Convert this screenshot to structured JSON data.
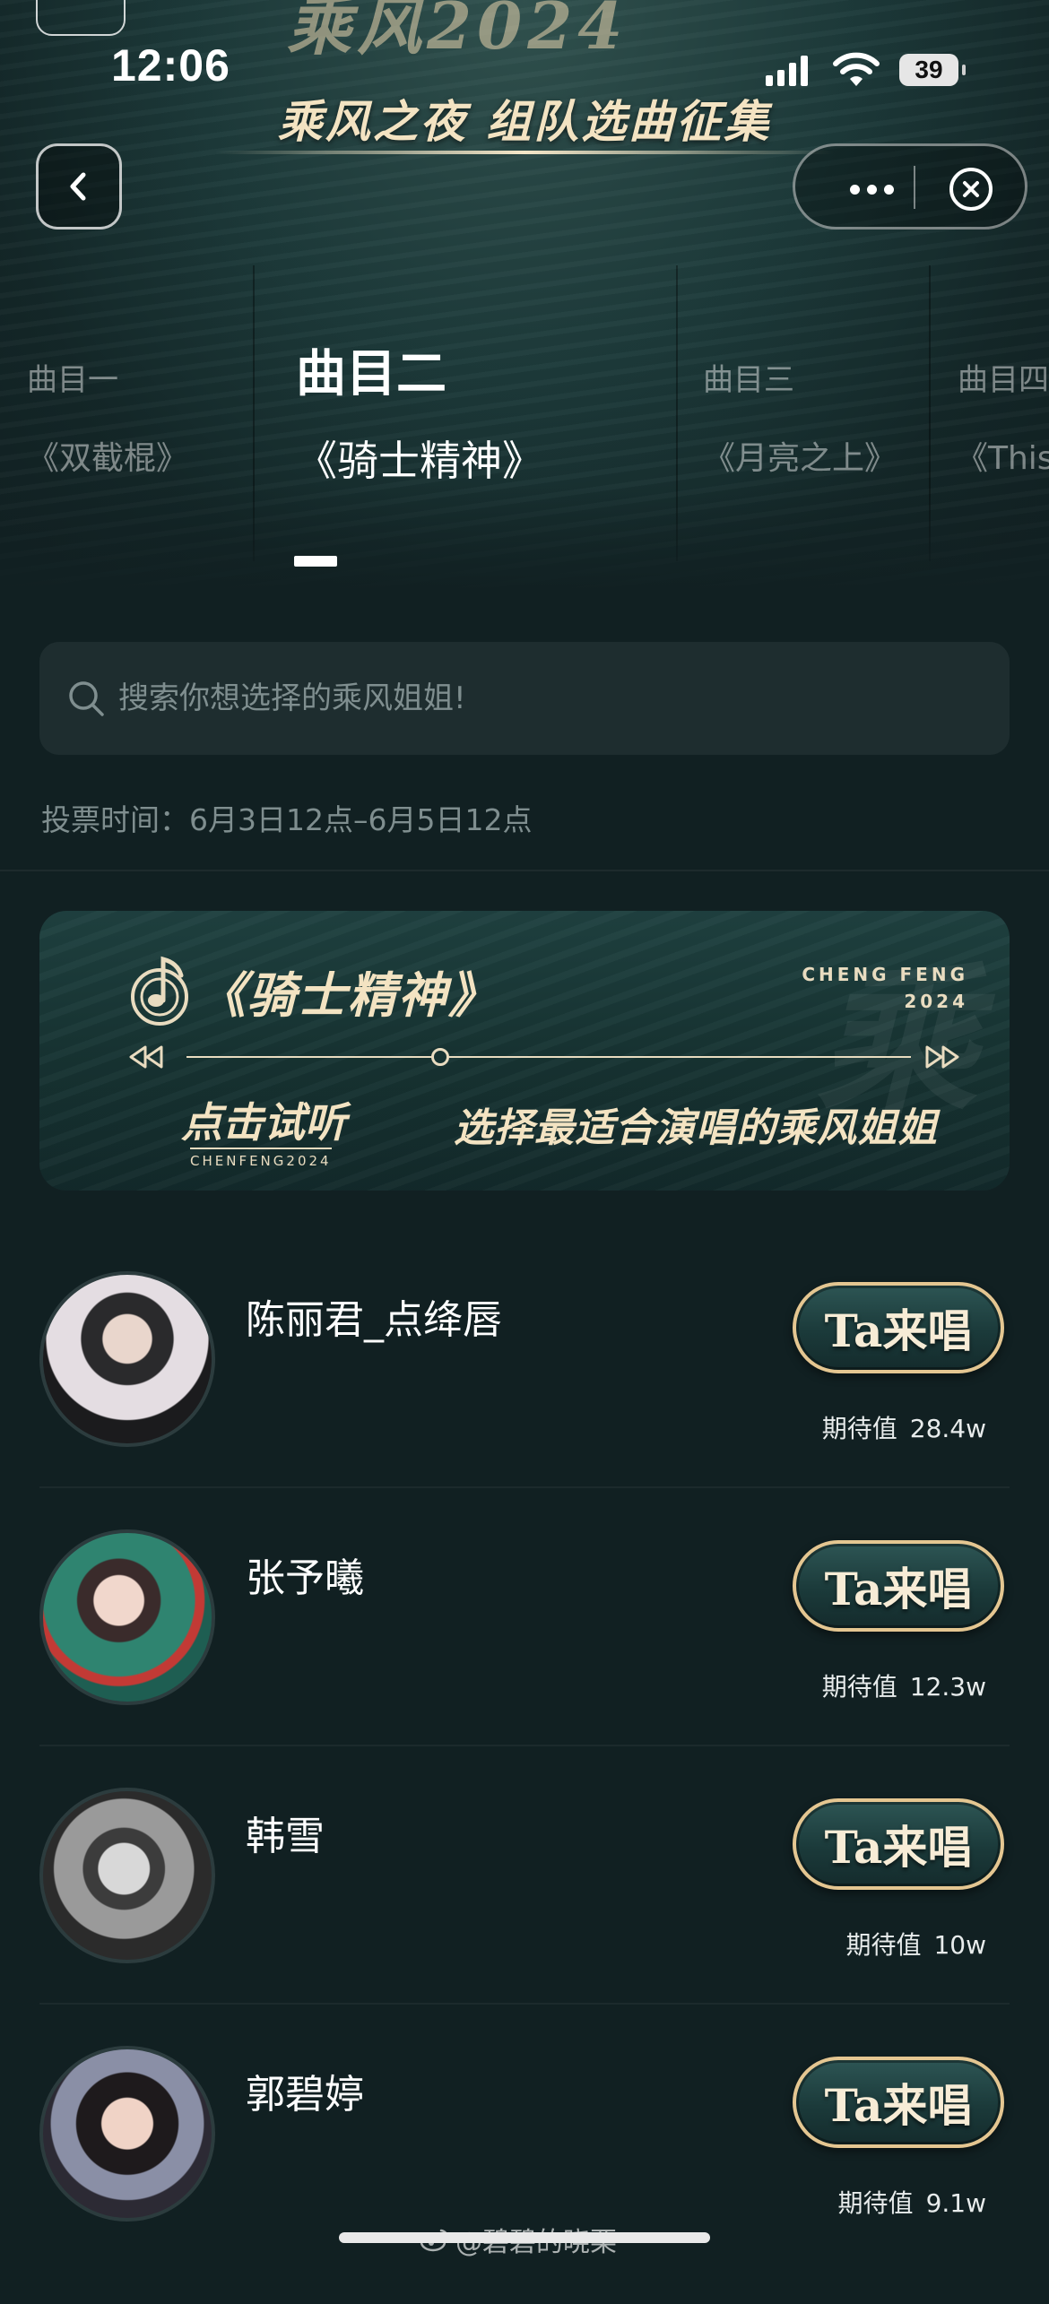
{
  "status_bar": {
    "time": "12:06",
    "battery": "39",
    "icons": [
      "signal-icon",
      "wifi-icon",
      "battery-icon"
    ]
  },
  "header": {
    "banner_subtitle": "乘风之夜 组队选曲征集",
    "back_icon": "chevron-left-icon",
    "menu_icon": "more-dots-icon",
    "close_icon": "close-circle-icon"
  },
  "tabs": [
    {
      "label": "曲目一",
      "song": "《双截棍》",
      "active": false
    },
    {
      "label": "曲目二",
      "song": "《骑士精神》",
      "active": true
    },
    {
      "label": "曲目三",
      "song": "《月亮之上》",
      "active": false
    },
    {
      "label": "曲目四",
      "song": "《This",
      "active": false
    }
  ],
  "search": {
    "placeholder": "搜索你想选择的乘风姐姐!"
  },
  "vote_time": "投票时间：6月3日12点–6月5日12点",
  "song_card": {
    "title": "《骑士精神》",
    "brand_line1": "CHENG FENG",
    "brand_line2": "2024",
    "listen_label": "点击试听",
    "listen_sub": "CHENFENG2024",
    "slogan": "选择最适合演唱的乘风姐姐",
    "progress": 0.35
  },
  "singers": [
    {
      "name": "陈丽君_点绛唇",
      "button": "Ta来唱",
      "expect_label": "期待值",
      "expect_value": "28.4w"
    },
    {
      "name": "张予曦",
      "button": "Ta来唱",
      "expect_label": "期待值",
      "expect_value": "12.3w"
    },
    {
      "name": "韩雪",
      "button": "Ta来唱",
      "expect_label": "期待值",
      "expect_value": "10w"
    },
    {
      "name": "郭碧婷",
      "button": "Ta来唱",
      "expect_label": "期待值",
      "expect_value": "9.1w"
    }
  ],
  "watermark": "@碧碧的晓栗",
  "colors": {
    "background": "#112022",
    "accent_gold": "#e4c691",
    "card_teal": "#1f4140"
  }
}
